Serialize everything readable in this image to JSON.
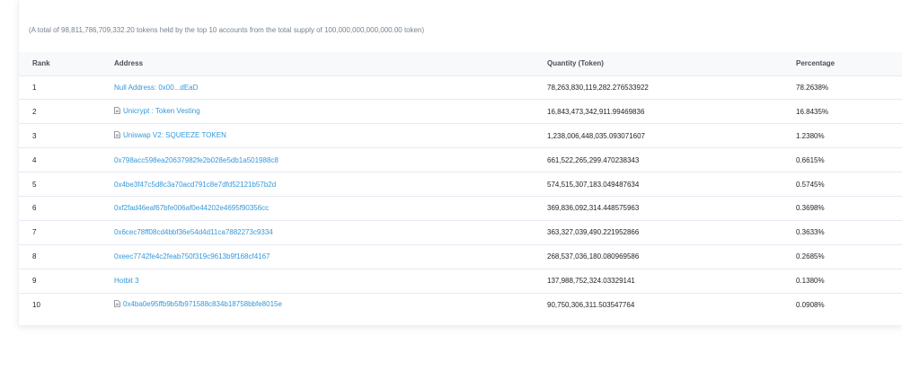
{
  "summary": "(A total of 98,811,786,709,332.20 tokens held by the top 10 accounts from the total supply of 100,000,000,000,000.00 token)",
  "headers": {
    "rank": "Rank",
    "address": "Address",
    "quantity": "Quantity (Token)",
    "percentage": "Percentage"
  },
  "link_color": "#3498db",
  "rows": [
    {
      "rank": "1",
      "address": "Null Address: 0x00...dEaD",
      "icon": "",
      "quantity": "78,263,830,119,282.276533922",
      "percentage": "78.2638%"
    },
    {
      "rank": "2",
      "address": "Unicrypt : Token Vesting",
      "icon": "contract-icon",
      "quantity": "16,843,473,342,911.99469836",
      "percentage": "16.8435%"
    },
    {
      "rank": "3",
      "address": "Uniswap V2: SQUEEZE TOKEN",
      "icon": "contract-icon",
      "quantity": "1,238,006,448,035.093071607",
      "percentage": "1.2380%"
    },
    {
      "rank": "4",
      "address": "0x798acc598ea20637982fe2b028e5db1a501988c8",
      "icon": "",
      "quantity": "661,522,265,299.470238343",
      "percentage": "0.6615%"
    },
    {
      "rank": "5",
      "address": "0x4be3f47c5d8c3a70acd791c8e7dfd52121b57b2d",
      "icon": "",
      "quantity": "574,515,307,183.049487634",
      "percentage": "0.5745%"
    },
    {
      "rank": "6",
      "address": "0xf2fad46eaf67bfe006af0e44202e4695f90356cc",
      "icon": "",
      "quantity": "369,836,092,314.448575963",
      "percentage": "0.3698%"
    },
    {
      "rank": "7",
      "address": "0x6cec78ff08cd4bbf36e54d4d11ca7882273c9334",
      "icon": "",
      "quantity": "363,327,039,490.221952866",
      "percentage": "0.3633%"
    },
    {
      "rank": "8",
      "address": "0xeec7742fe4c2feab750f319c9613b9f168cf4167",
      "icon": "",
      "quantity": "268,537,036,180.080969586",
      "percentage": "0.2685%"
    },
    {
      "rank": "9",
      "address": "Hotbit 3",
      "icon": "",
      "quantity": "137,988,752,324.03329141",
      "percentage": "0.1380%"
    },
    {
      "rank": "10",
      "address": "0x4ba0e95ffb9b5fb971588c834b18758bbfe8015e",
      "icon": "contract-icon",
      "quantity": "90,750,306,311.503547764",
      "percentage": "0.0908%"
    }
  ]
}
